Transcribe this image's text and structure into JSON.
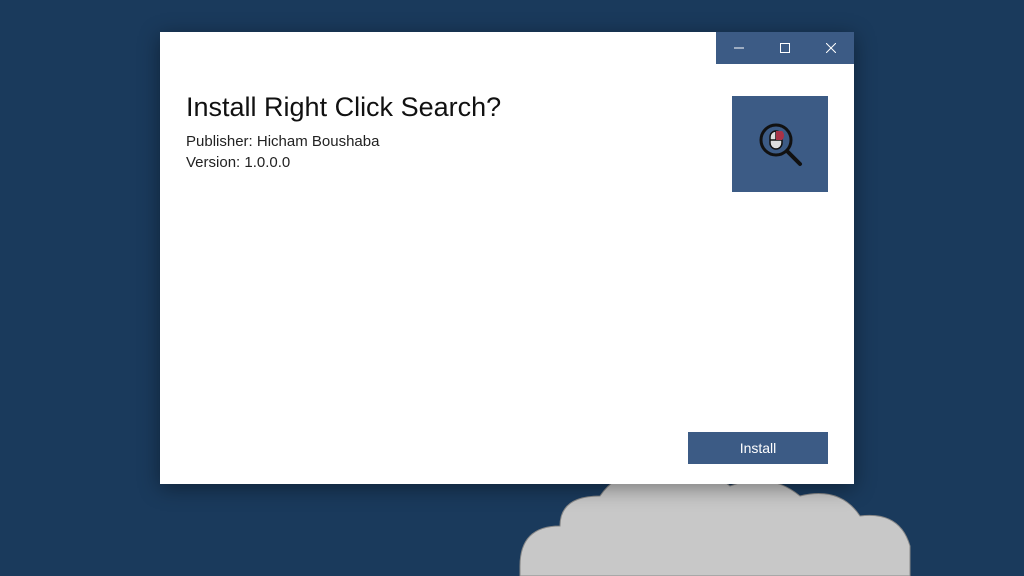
{
  "dialog": {
    "heading": "Install Right Click Search?",
    "publisher_label": "Publisher: Hicham Boushaba",
    "version_label": "Version: 1.0.0.0",
    "install_button": "Install"
  },
  "colors": {
    "accent": "#3c5b85",
    "background": "#1a3a5c"
  },
  "icons": {
    "minimize": "minimize-icon",
    "maximize": "maximize-icon",
    "close": "close-icon",
    "app": "mouse-search-icon"
  }
}
